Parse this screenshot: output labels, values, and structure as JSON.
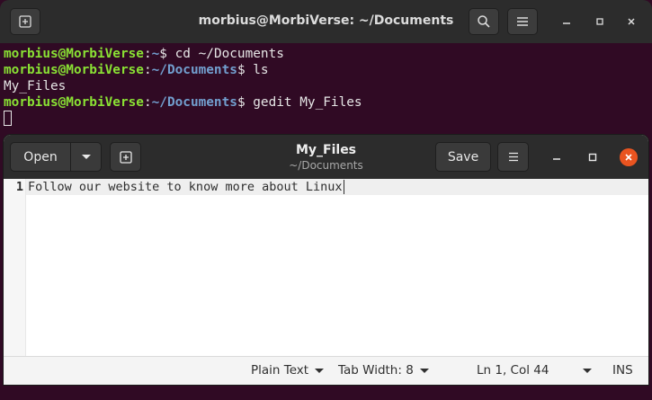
{
  "terminal": {
    "title": "morbius@MorbiVerse: ~/Documents",
    "lines": [
      {
        "user": "morbius@MorbiVerse",
        "sep": ":",
        "path": "~",
        "prompt": "$ ",
        "cmd": "cd ~/Documents"
      },
      {
        "user": "morbius@MorbiVerse",
        "sep": ":",
        "path": "~/Documents",
        "prompt": "$ ",
        "cmd": "ls"
      },
      {
        "output": "My_Files"
      },
      {
        "user": "morbius@MorbiVerse",
        "sep": ":",
        "path": "~/Documents",
        "prompt": "$ ",
        "cmd": "gedit My_Files"
      }
    ],
    "icons": {
      "new_tab": "new-tab-icon",
      "search": "search-icon",
      "menu": "hamburger-menu-icon",
      "minimize": "minimize-icon",
      "maximize": "restore-icon",
      "close": "close-icon"
    }
  },
  "gedit": {
    "open_label": "Open",
    "title": "My_Files",
    "subtitle": "~/Documents",
    "save_label": "Save",
    "editor": {
      "line_number": "1",
      "line_text": "Follow our website to know more about Linux"
    },
    "status": {
      "language": "Plain Text",
      "tab_width": "Tab Width: 8",
      "position": "Ln 1, Col 44",
      "mode": "INS"
    }
  },
  "colors": {
    "terminal_bg": "#300a24",
    "prompt_user": "#8ae234",
    "prompt_path": "#729fcf",
    "close_button": "#e95420",
    "headerbar": "#2c2c2c"
  }
}
